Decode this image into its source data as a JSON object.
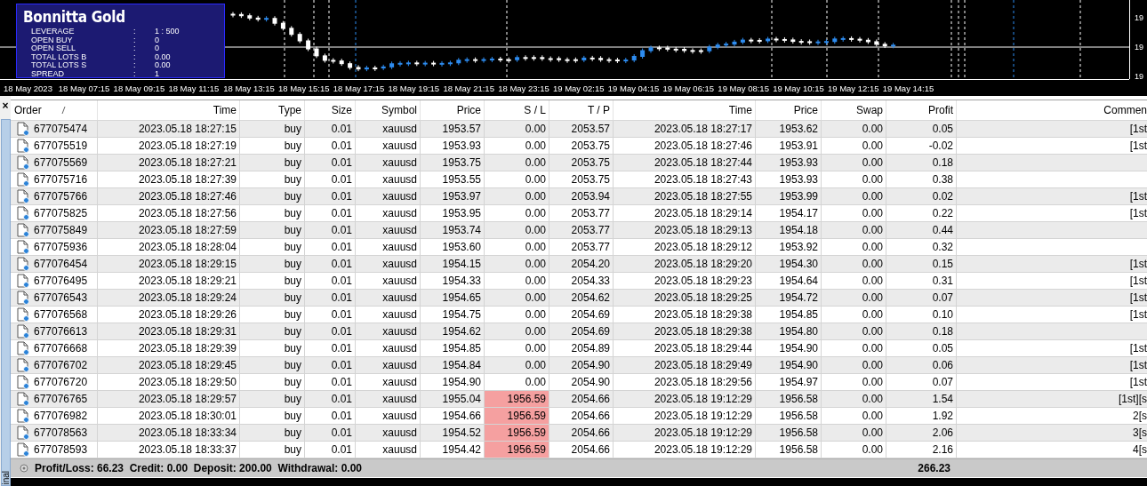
{
  "chart": {
    "info_panel": {
      "title": "Bonnitta Gold",
      "rows": [
        {
          "label": "LEVERAGE",
          "separator": ":",
          "value": "1 : 500"
        },
        {
          "label": "OPEN BUY",
          "separator": ":",
          "value": "0"
        },
        {
          "label": "OPEN SELL",
          "separator": ":",
          "value": "0"
        },
        {
          "label": "TOTAL LOTS B",
          "separator": ":",
          "value": "0.00"
        },
        {
          "label": "TOTAL LOTS S",
          "separator": ":",
          "value": "0.00"
        },
        {
          "label": "SPREAD",
          "separator": ":",
          "value": "1"
        }
      ]
    },
    "price_labels": [
      "19",
      "19",
      "19"
    ],
    "time_labels": [
      "18 May 2023",
      "18 May 07:15",
      "18 May 09:15",
      "18 May 11:15",
      "18 May 13:15",
      "18 May 15:15",
      "18 May 17:15",
      "18 May 19:15",
      "18 May 21:15",
      "18 May 23:15",
      "19 May 02:15",
      "19 May 04:15",
      "19 May 06:15",
      "19 May 08:15",
      "19 May 10:15",
      "19 May 12:15",
      "19 May 14:15"
    ]
  },
  "terminal": {
    "close_label": "×",
    "tab_label": "inal",
    "columns": [
      "Order",
      "Time",
      "Type",
      "Size",
      "Symbol",
      "Price",
      "S / L",
      "T / P",
      "Time",
      "Price",
      "Swap",
      "Profit",
      "Commen"
    ],
    "rows": [
      {
        "order": "677075474",
        "open_time": "2023.05.18 18:27:15",
        "type": "buy",
        "size": "0.01",
        "symbol": "xauusd",
        "price": "1953.57",
        "sl": "0.00",
        "tp": "2053.57",
        "close_time": "2023.05.18 18:27:17",
        "close_price": "1953.62",
        "swap": "0.00",
        "profit": "0.05",
        "comment": "[1st",
        "sl_alert": false
      },
      {
        "order": "677075519",
        "open_time": "2023.05.18 18:27:19",
        "type": "buy",
        "size": "0.01",
        "symbol": "xauusd",
        "price": "1953.93",
        "sl": "0.00",
        "tp": "2053.75",
        "close_time": "2023.05.18 18:27:46",
        "close_price": "1953.91",
        "swap": "0.00",
        "profit": "-0.02",
        "comment": "[1st",
        "sl_alert": false
      },
      {
        "order": "677075569",
        "open_time": "2023.05.18 18:27:21",
        "type": "buy",
        "size": "0.01",
        "symbol": "xauusd",
        "price": "1953.75",
        "sl": "0.00",
        "tp": "2053.75",
        "close_time": "2023.05.18 18:27:44",
        "close_price": "1953.93",
        "swap": "0.00",
        "profit": "0.18",
        "sl_alert": false
      },
      {
        "order": "677075716",
        "open_time": "2023.05.18 18:27:39",
        "type": "buy",
        "size": "0.01",
        "symbol": "xauusd",
        "price": "1953.55",
        "sl": "0.00",
        "tp": "2053.75",
        "close_time": "2023.05.18 18:27:43",
        "close_price": "1953.93",
        "swap": "0.00",
        "profit": "0.38",
        "sl_alert": false
      },
      {
        "order": "677075766",
        "open_time": "2023.05.18 18:27:46",
        "type": "buy",
        "size": "0.01",
        "symbol": "xauusd",
        "price": "1953.97",
        "sl": "0.00",
        "tp": "2053.94",
        "close_time": "2023.05.18 18:27:55",
        "close_price": "1953.99",
        "swap": "0.00",
        "profit": "0.02",
        "comment": "[1st",
        "sl_alert": false
      },
      {
        "order": "677075825",
        "open_time": "2023.05.18 18:27:56",
        "type": "buy",
        "size": "0.01",
        "symbol": "xauusd",
        "price": "1953.95",
        "sl": "0.00",
        "tp": "2053.77",
        "close_time": "2023.05.18 18:29:14",
        "close_price": "1954.17",
        "swap": "0.00",
        "profit": "0.22",
        "comment": "[1st",
        "sl_alert": false
      },
      {
        "order": "677075849",
        "open_time": "2023.05.18 18:27:59",
        "type": "buy",
        "size": "0.01",
        "symbol": "xauusd",
        "price": "1953.74",
        "sl": "0.00",
        "tp": "2053.77",
        "close_time": "2023.05.18 18:29:13",
        "close_price": "1954.18",
        "swap": "0.00",
        "profit": "0.44",
        "sl_alert": false
      },
      {
        "order": "677075936",
        "open_time": "2023.05.18 18:28:04",
        "type": "buy",
        "size": "0.01",
        "symbol": "xauusd",
        "price": "1953.60",
        "sl": "0.00",
        "tp": "2053.77",
        "close_time": "2023.05.18 18:29:12",
        "close_price": "1953.92",
        "swap": "0.00",
        "profit": "0.32",
        "sl_alert": false
      },
      {
        "order": "677076454",
        "open_time": "2023.05.18 18:29:15",
        "type": "buy",
        "size": "0.01",
        "symbol": "xauusd",
        "price": "1954.15",
        "sl": "0.00",
        "tp": "2054.20",
        "close_time": "2023.05.18 18:29:20",
        "close_price": "1954.30",
        "swap": "0.00",
        "profit": "0.15",
        "comment": "[1st",
        "sl_alert": false
      },
      {
        "order": "677076495",
        "open_time": "2023.05.18 18:29:21",
        "type": "buy",
        "size": "0.01",
        "symbol": "xauusd",
        "price": "1954.33",
        "sl": "0.00",
        "tp": "2054.33",
        "close_time": "2023.05.18 18:29:23",
        "close_price": "1954.64",
        "swap": "0.00",
        "profit": "0.31",
        "comment": "[1st",
        "sl_alert": false
      },
      {
        "order": "677076543",
        "open_time": "2023.05.18 18:29:24",
        "type": "buy",
        "size": "0.01",
        "symbol": "xauusd",
        "price": "1954.65",
        "sl": "0.00",
        "tp": "2054.62",
        "close_time": "2023.05.18 18:29:25",
        "close_price": "1954.72",
        "swap": "0.00",
        "profit": "0.07",
        "comment": "[1st",
        "sl_alert": false
      },
      {
        "order": "677076568",
        "open_time": "2023.05.18 18:29:26",
        "type": "buy",
        "size": "0.01",
        "symbol": "xauusd",
        "price": "1954.75",
        "sl": "0.00",
        "tp": "2054.69",
        "close_time": "2023.05.18 18:29:38",
        "close_price": "1954.85",
        "swap": "0.00",
        "profit": "0.10",
        "comment": "[1st",
        "sl_alert": false
      },
      {
        "order": "677076613",
        "open_time": "2023.05.18 18:29:31",
        "type": "buy",
        "size": "0.01",
        "symbol": "xauusd",
        "price": "1954.62",
        "sl": "0.00",
        "tp": "2054.69",
        "close_time": "2023.05.18 18:29:38",
        "close_price": "1954.80",
        "swap": "0.00",
        "profit": "0.18",
        "sl_alert": false
      },
      {
        "order": "677076668",
        "open_time": "2023.05.18 18:29:39",
        "type": "buy",
        "size": "0.01",
        "symbol": "xauusd",
        "price": "1954.85",
        "sl": "0.00",
        "tp": "2054.89",
        "close_time": "2023.05.18 18:29:44",
        "close_price": "1954.90",
        "swap": "0.00",
        "profit": "0.05",
        "comment": "[1st",
        "sl_alert": false
      },
      {
        "order": "677076702",
        "open_time": "2023.05.18 18:29:45",
        "type": "buy",
        "size": "0.01",
        "symbol": "xauusd",
        "price": "1954.84",
        "sl": "0.00",
        "tp": "2054.90",
        "close_time": "2023.05.18 18:29:49",
        "close_price": "1954.90",
        "swap": "0.00",
        "profit": "0.06",
        "comment": "[1st",
        "sl_alert": false
      },
      {
        "order": "677076720",
        "open_time": "2023.05.18 18:29:50",
        "type": "buy",
        "size": "0.01",
        "symbol": "xauusd",
        "price": "1954.90",
        "sl": "0.00",
        "tp": "2054.90",
        "close_time": "2023.05.18 18:29:56",
        "close_price": "1954.97",
        "swap": "0.00",
        "profit": "0.07",
        "comment": "[1st",
        "sl_alert": false
      },
      {
        "order": "677076765",
        "open_time": "2023.05.18 18:29:57",
        "type": "buy",
        "size": "0.01",
        "symbol": "xauusd",
        "price": "1955.04",
        "sl": "1956.59",
        "tp": "2054.66",
        "close_time": "2023.05.18 19:12:29",
        "close_price": "1956.58",
        "swap": "0.00",
        "profit": "1.54",
        "comment": "[1st][s",
        "sl_alert": true
      },
      {
        "order": "677076982",
        "open_time": "2023.05.18 18:30:01",
        "type": "buy",
        "size": "0.01",
        "symbol": "xauusd",
        "price": "1954.66",
        "sl": "1956.59",
        "tp": "2054.66",
        "close_time": "2023.05.18 19:12:29",
        "close_price": "1956.58",
        "swap": "0.00",
        "profit": "1.92",
        "comment": "2[s",
        "sl_alert": true
      },
      {
        "order": "677078563",
        "open_time": "2023.05.18 18:33:34",
        "type": "buy",
        "size": "0.01",
        "symbol": "xauusd",
        "price": "1954.52",
        "sl": "1956.59",
        "tp": "2054.66",
        "close_time": "2023.05.18 19:12:29",
        "close_price": "1956.58",
        "swap": "0.00",
        "profit": "2.06",
        "comment": "3[s",
        "sl_alert": true
      },
      {
        "order": "677078593",
        "open_time": "2023.05.18 18:33:37",
        "type": "buy",
        "size": "0.01",
        "symbol": "xauusd",
        "price": "1954.42",
        "sl": "1956.59",
        "tp": "2054.66",
        "close_time": "2023.05.18 19:12:29",
        "close_price": "1956.58",
        "swap": "0.00",
        "profit": "2.16",
        "comment": "4[s",
        "sl_alert": true
      }
    ],
    "summary": {
      "text": "Profit/Loss: 66.23  Credit: 0.00  Deposit: 200.00  Withdrawal: 0.00",
      "total": "266.23"
    }
  }
}
